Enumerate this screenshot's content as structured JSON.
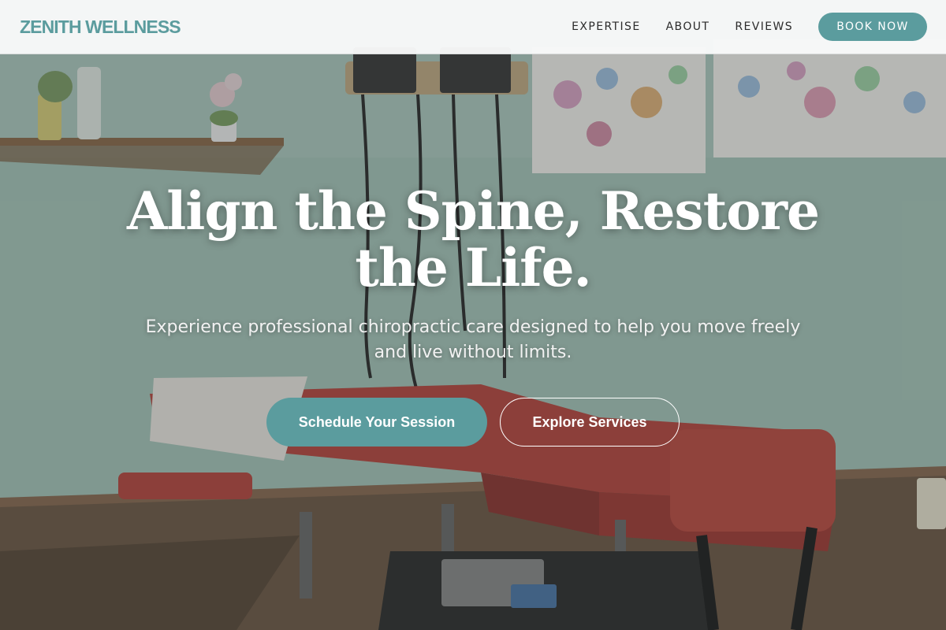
{
  "header": {
    "brand": "ZENITH WELLNESS",
    "nav": [
      {
        "label": "EXPERTISE"
      },
      {
        "label": "ABOUT"
      },
      {
        "label": "REVIEWS"
      }
    ],
    "cta_label": "BOOK NOW"
  },
  "hero": {
    "title_line1": "Align the Spine, Restore",
    "title_line2": "the Life.",
    "subtitle_line1": "Experience professional chiropractic care designed to help you move freely",
    "subtitle_line2": "and live without limits.",
    "primary_button": "Schedule Your Session",
    "secondary_button": "Explore Services",
    "background_image": "chiropractic-treatment-room"
  },
  "colors": {
    "accent": "#5b9c9e",
    "header_bg": "#f8f9f9",
    "wall": "#a7c6bb",
    "table_red": "#b8473f",
    "text_light": "#ffffff"
  }
}
